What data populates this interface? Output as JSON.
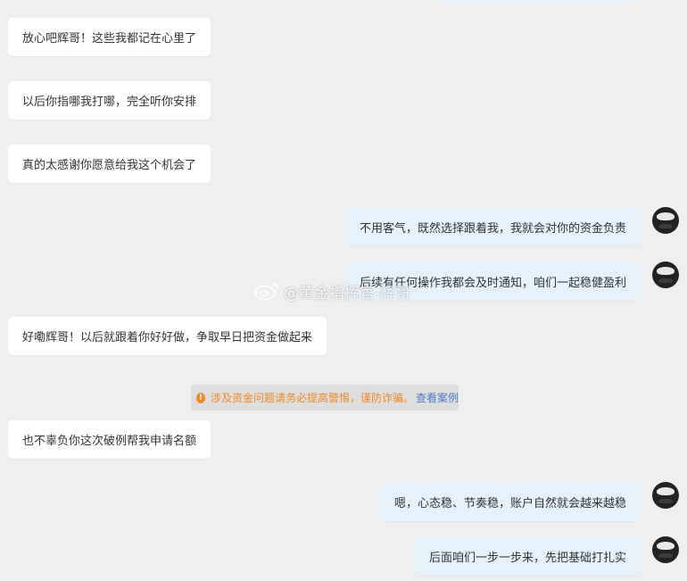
{
  "messages": [
    {
      "side": "left",
      "text": "放心吧辉哥！这些我都记在心里了"
    },
    {
      "side": "left",
      "text": "以后你指哪我打哪，完全听你安排"
    },
    {
      "side": "left",
      "text": "真的太感谢你愿意给我这个机会了"
    },
    {
      "side": "right",
      "text": "不用客气，既然选择跟着我，我就会对你的资金负责"
    },
    {
      "side": "right",
      "text": "后续有任何操作我都会及时通知，咱们一起稳健盈利"
    },
    {
      "side": "left",
      "text": "好嘞辉哥！以后就跟着你好好做，争取早日把资金做起来"
    },
    {
      "side": "left",
      "text": "也不辜负你这次破例帮我申请名额"
    },
    {
      "side": "right",
      "text": "嗯，心态稳、节奏稳，账户自然就会越来越稳"
    },
    {
      "side": "right",
      "text": "后面咱们一步一步来，先把基础打扎实"
    }
  ],
  "notice": {
    "icon": "!",
    "text": "涉及资金问题请务必提高警惕，谨防诈骗。",
    "link": "查看案例",
    "text_color": "#f08a24",
    "link_color": "#4a7ec9"
  },
  "watermark": {
    "text": "@黄金指挥官-辉哥",
    "icon": "weibo-icon"
  },
  "colors": {
    "background": "#efefef",
    "bubble_left": "#ffffff",
    "bubble_right": "#e6f2fb"
  }
}
